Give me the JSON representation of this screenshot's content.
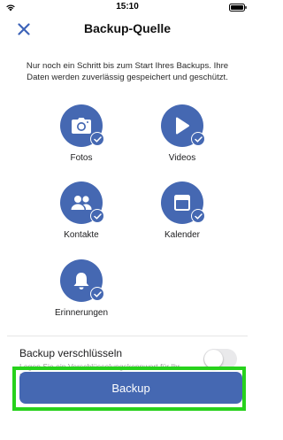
{
  "status_bar": {
    "time": "15:10"
  },
  "nav": {
    "title": "Backup-Quelle",
    "close_icon": "close-icon"
  },
  "intro_text": "Nur noch ein Schritt bis zum Start Ihres Backups. Ihre Daten werden zuverlässig gespeichert und geschützt.",
  "sources": [
    {
      "label": "Fotos",
      "icon": "camera-icon",
      "selected": true
    },
    {
      "label": "Videos",
      "icon": "play-icon",
      "selected": true
    },
    {
      "label": "Kontakte",
      "icon": "contacts-icon",
      "selected": true
    },
    {
      "label": "Kalender",
      "icon": "calendar-icon",
      "selected": true
    },
    {
      "label": "Erinnerungen",
      "icon": "bell-icon",
      "selected": true
    }
  ],
  "encryption": {
    "title": "Backup verschlüsseln",
    "description": "Legen Sie ein Verschlüsselungskennwort für Ihr Backup fest",
    "enabled": false
  },
  "backup_button": {
    "label": "Backup"
  },
  "colors": {
    "accent": "#4568b2",
    "highlight": "#27d21c"
  }
}
